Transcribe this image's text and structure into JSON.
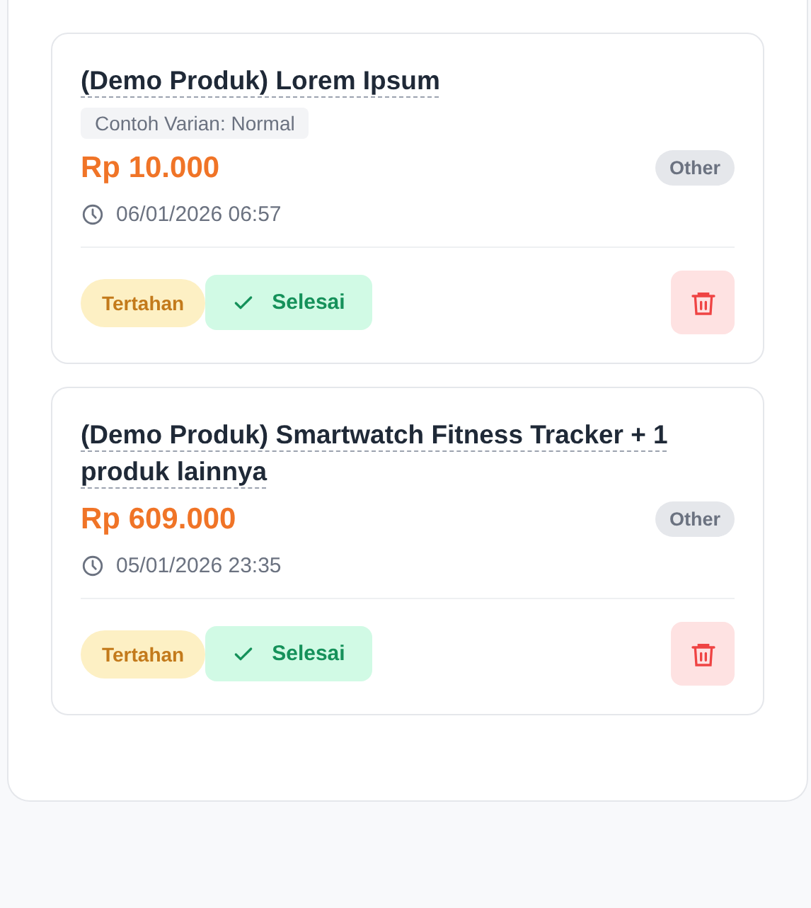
{
  "orders": [
    {
      "title": "(Demo Produk) Lorem Ipsum",
      "variant": "Contoh Varian: Normal",
      "price": "Rp 10.000",
      "category": "Other",
      "datetime": "06/01/2026 06:57",
      "status": "Tertahan",
      "action": "Selesai"
    },
    {
      "title": "(Demo Produk) Smartwatch Fitness Tracker + 1 produk lainnya",
      "price": "Rp 609.000",
      "category": "Other",
      "datetime": "05/01/2026 23:35",
      "status": "Tertahan",
      "action": "Selesai"
    }
  ]
}
